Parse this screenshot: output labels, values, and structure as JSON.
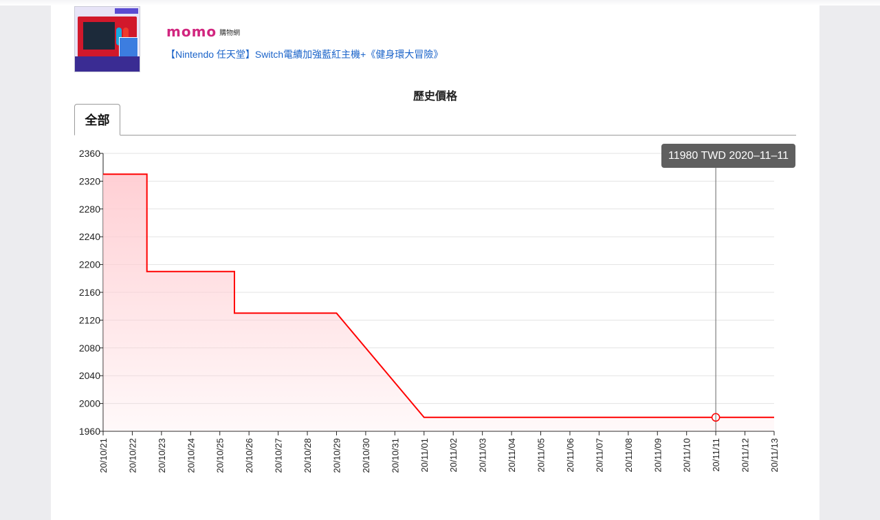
{
  "product": {
    "store_logo": "momo",
    "store_sub": "購物網",
    "name": "【Nintendo 任天堂】Switch電續加強藍紅主機+《健身環大冒險》",
    "thumbnail_alt": "Nintendo Switch 主機 與 健身環大冒險"
  },
  "section_title": "歷史價格",
  "tabs": [
    {
      "label": "全部",
      "active": true
    }
  ],
  "tooltip": {
    "text": "11980  TWD 2020–11–11"
  },
  "colors": {
    "line": "#ff0000",
    "fill_top": "#ffcdd2",
    "grid": "#e3e3e3",
    "brand": "#d1267f",
    "link": "#1a63c9"
  },
  "chart_data": {
    "type": "line",
    "step": true,
    "xlabel": "",
    "ylabel": "",
    "ylim": [
      1960,
      2360
    ],
    "yticks": [
      1960,
      2000,
      2040,
      2080,
      2120,
      2160,
      2200,
      2240,
      2280,
      2320,
      2360
    ],
    "categories": [
      "20/10/21",
      "20/10/22",
      "20/10/23",
      "20/10/24",
      "20/10/25",
      "20/10/26",
      "20/10/27",
      "20/10/28",
      "20/10/29",
      "20/10/30",
      "20/10/31",
      "20/11/01",
      "20/11/02",
      "20/11/03",
      "20/11/04",
      "20/11/05",
      "20/11/06",
      "20/11/07",
      "20/11/08",
      "20/11/09",
      "20/11/10",
      "20/11/11",
      "20/11/12",
      "20/11/13"
    ],
    "series": [
      {
        "points": [
          [
            0,
            2330
          ],
          [
            1.5,
            2330
          ],
          [
            1.5,
            2190
          ],
          [
            4.5,
            2190
          ],
          [
            4.5,
            2130
          ],
          [
            8,
            2130
          ],
          [
            11,
            1980
          ],
          [
            23,
            1980
          ]
        ]
      }
    ],
    "highlight": {
      "x": 21,
      "y": 1980
    },
    "grid": true
  }
}
